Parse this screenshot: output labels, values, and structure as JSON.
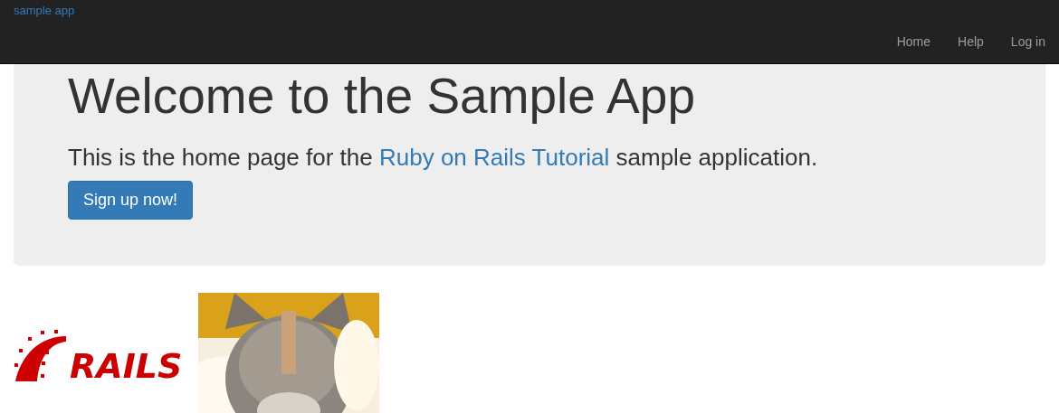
{
  "navbar": {
    "brand": "sample app",
    "links": [
      "Home",
      "Help",
      "Log in"
    ]
  },
  "hero": {
    "title": "Welcome to the Sample App",
    "text_before": "This is the home page for the ",
    "link": "Ruby on Rails Tutorial",
    "text_after": " sample application.",
    "button": "Sign up now!"
  },
  "images": {
    "logo_text": "RAILS"
  }
}
